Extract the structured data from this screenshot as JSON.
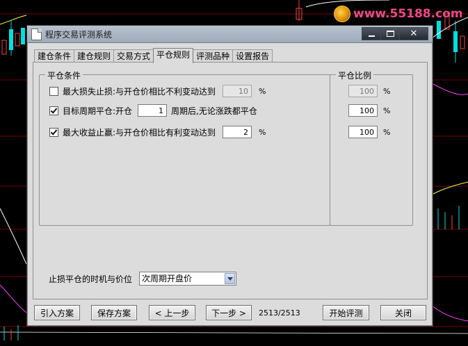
{
  "watermark": {
    "text": "www.55188.com"
  },
  "window": {
    "title": "程序交易评测系统",
    "controls": {
      "minimize": "min",
      "maximize": "max",
      "close": "x"
    }
  },
  "tabs": [
    {
      "label": "建仓条件",
      "active": false
    },
    {
      "label": "建仓规则",
      "active": false
    },
    {
      "label": "交易方式",
      "active": false
    },
    {
      "label": "平仓规则",
      "active": true
    },
    {
      "label": "评测品种",
      "active": false
    },
    {
      "label": "设置报告",
      "active": false
    }
  ],
  "close_conditions": {
    "title": "平仓条件",
    "stop_loss": {
      "checked": false,
      "label": "最大损失止损:与开仓价相比不利变动达到",
      "value": "10",
      "unit": "%",
      "enabled": false
    },
    "target_period": {
      "checked": true,
      "label_before": "目标周期平仓:开仓",
      "value": "1",
      "label_after": "周期后,无论涨跌都平仓"
    },
    "take_profit": {
      "checked": true,
      "label": "最大收益止赢:与开仓价相比有利变动达到",
      "value": "2",
      "unit": "%"
    }
  },
  "close_ratio": {
    "title": "平仓比例",
    "values": [
      "100",
      "100",
      "100"
    ],
    "unit": "%",
    "first_enabled": false
  },
  "timing": {
    "label": "止损平仓的时机与价位",
    "selected": "次周期开盘价"
  },
  "footer": {
    "import_label": "引入方案",
    "save_label": "保存方案",
    "prev_label": "< 上一步",
    "next_label": "下一步 >",
    "counter": "2513/2513",
    "start_label": "开始评测",
    "close_label": "关闭"
  },
  "colors": {
    "background": "#000000",
    "dialog": "#dcdcdc",
    "titlebar": "#a9b5c3",
    "watermark_text": "#e84a8a"
  }
}
